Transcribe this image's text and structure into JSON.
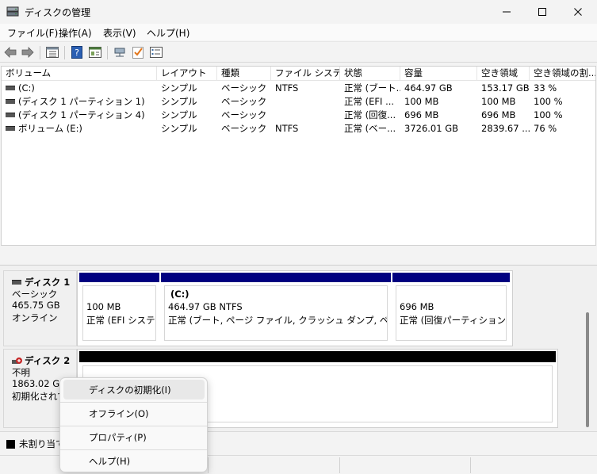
{
  "window": {
    "title": "ディスクの管理"
  },
  "menu": [
    "ファイル(F)",
    "操作(A)",
    "表示(V)",
    "ヘルプ(H)"
  ],
  "toolbar_icons": [
    "back-arrow-icon",
    "forward-arrow-icon",
    "list-view-icon",
    "help-icon",
    "properties-icon",
    "connect-icon",
    "check-icon",
    "settings-list-icon"
  ],
  "volume_table": {
    "columns": [
      "ボリューム",
      "レイアウト",
      "種類",
      "ファイル システム",
      "状態",
      "容量",
      "空き領域",
      "空き領域の割..."
    ],
    "rows": [
      [
        "(C:)",
        "シンプル",
        "ベーシック",
        "NTFS",
        "正常 (ブート...",
        "464.97 GB",
        "153.17 GB",
        "33 %"
      ],
      [
        "(ディスク 1 パーティション 1)",
        "シンプル",
        "ベーシック",
        "",
        "正常 (EFI ...",
        "100 MB",
        "100 MB",
        "100 %"
      ],
      [
        "(ディスク 1 パーティション 4)",
        "シンプル",
        "ベーシック",
        "",
        "正常 (回復...",
        "696 MB",
        "696 MB",
        "100 %"
      ],
      [
        "ボリューム (E:)",
        "シンプル",
        "ベーシック",
        "NTFS",
        "正常 (ベー...",
        "3726.01 GB",
        "2839.67 ...",
        "76 %"
      ]
    ]
  },
  "disk1": {
    "name": "ディスク 1",
    "type": "ベーシック",
    "size": "465.75 GB",
    "status": "オンライン",
    "partitions": [
      {
        "line1": "",
        "line2": "100 MB",
        "line3": "正常 (EFI システム"
      },
      {
        "line1": "(C:)",
        "line2": "464.97 GB NTFS",
        "line3": "正常 (ブート, ページ ファイル, クラッシュ ダンプ, ベーシック デー"
      },
      {
        "line1": "",
        "line2": "696 MB",
        "line3": "正常 (回復パーティション)"
      }
    ]
  },
  "disk2": {
    "name": "ディスク 2",
    "type": "不明",
    "size": "1863.02 GB",
    "status": "初期化されて"
  },
  "legend": {
    "unallocated": "未割り当て"
  },
  "context_menu": {
    "items": [
      "ディスクの初期化(I)",
      "オフライン(O)",
      "プロパティ(P)",
      "ヘルプ(H)"
    ]
  }
}
